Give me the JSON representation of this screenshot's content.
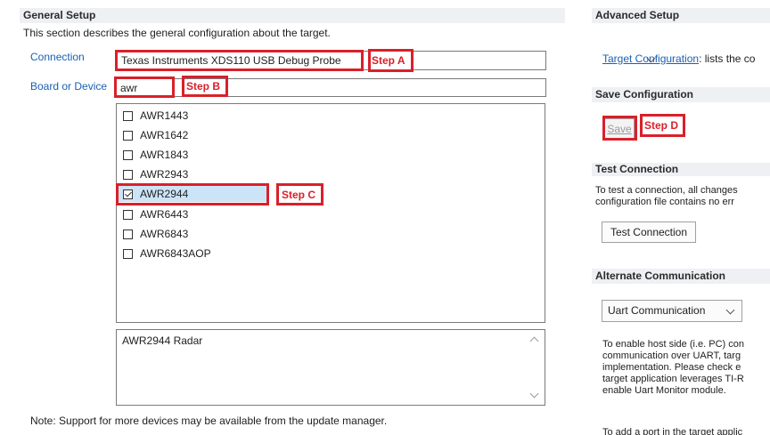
{
  "general": {
    "title": "General Setup",
    "description": "This section describes the general configuration about the target.",
    "connection_label": "Connection",
    "connection_value": "Texas Instruments XDS110 USB Debug Probe",
    "board_label": "Board or Device",
    "board_filter": "awr",
    "devices": [
      {
        "label": "AWR1443",
        "checked": false
      },
      {
        "label": "AWR1642",
        "checked": false
      },
      {
        "label": "AWR1843",
        "checked": false
      },
      {
        "label": "AWR2943",
        "checked": false
      },
      {
        "label": "AWR2944",
        "checked": true
      },
      {
        "label": "AWR6443",
        "checked": false
      },
      {
        "label": "AWR6843",
        "checked": false
      },
      {
        "label": "AWR6843AOP",
        "checked": false
      }
    ],
    "device_description": "AWR2944 Radar",
    "note": "Note: Support for more devices may be available from the update manager."
  },
  "advanced": {
    "title": "Advanced Setup",
    "target_config_link": "Target Configuration",
    "target_config_text": ": lists the co"
  },
  "save": {
    "title": "Save Configuration",
    "button_label": "Save"
  },
  "test": {
    "title": "Test Connection",
    "line1": "To test a connection, all changes",
    "line2": "configuration file contains no err",
    "button_label": "Test Connection"
  },
  "alternate": {
    "title": "Alternate Communication",
    "select_value": "Uart Communication",
    "lines": [
      "To enable host side (i.e. PC) con",
      "communication over UART, targ",
      "implementation. Please check e",
      "target application leverages TI-R",
      "enable Uart Monitor module."
    ],
    "last_line": "To add a port in the target applic"
  },
  "annotations": {
    "step_a": "Step A",
    "step_b": "Step B",
    "step_c": "Step C",
    "step_d": "Step D"
  },
  "colors": {
    "annotation": "#d9202a",
    "link": "#1a5fb4",
    "section_header_bg": "#eef0f3",
    "selection": "#cce4f7"
  }
}
